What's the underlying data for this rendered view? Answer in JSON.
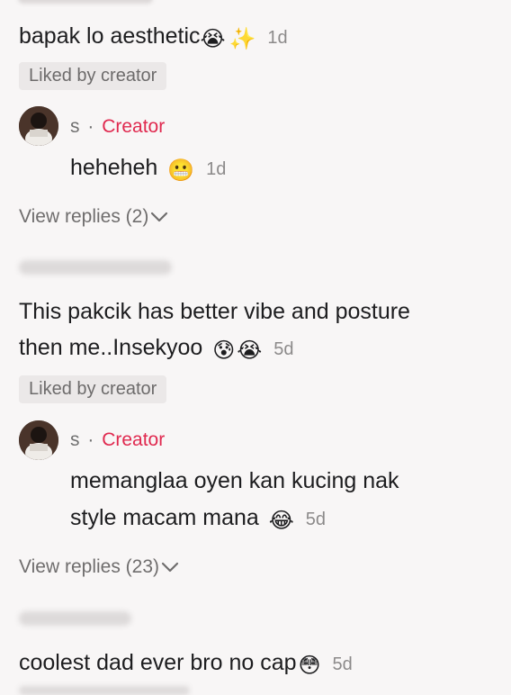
{
  "comments": [
    {
      "text": "bapak lo aesthetic",
      "emojis": [
        "😭",
        "✨"
      ],
      "time": "1d",
      "liked_badge": "Liked by creator",
      "reply": {
        "username": "s",
        "separator": "·",
        "creator_tag": "Creator",
        "text": "heheheh",
        "emojis": [
          "😬"
        ],
        "time": "1d"
      },
      "view_replies": "View replies (2)"
    },
    {
      "text_line1": "This pakcik has better vibe and posture",
      "text_line2": "then me..Insekyoo",
      "emojis": [
        "😰",
        "😭"
      ],
      "time": "5d",
      "liked_badge": "Liked by creator",
      "reply": {
        "username": "s",
        "separator": "·",
        "creator_tag": "Creator",
        "text_line1": "memanglaa oyen kan kucing nak",
        "text_line2": "style macam mana",
        "emojis": [
          "😂"
        ],
        "time": "5d"
      },
      "view_replies": "View replies (23)"
    },
    {
      "text": "coolest dad ever bro no cap",
      "emojis": [
        "😳"
      ],
      "time": "5d"
    }
  ],
  "icons": {
    "chevron": "chevron-down-icon",
    "avatar": "creator-avatar"
  },
  "colors": {
    "background": "#f8f6f6",
    "creator_tag": "#e0294f",
    "badge_bg": "#ebe8e8",
    "muted_text": "#8c8a8a"
  }
}
